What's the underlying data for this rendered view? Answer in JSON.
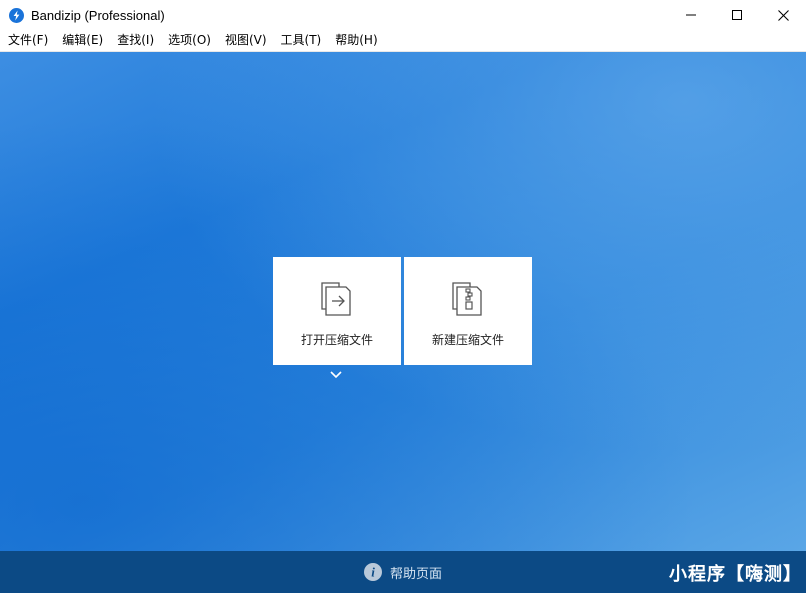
{
  "window": {
    "title": "Bandizip (Professional)",
    "controls": [
      "minimize",
      "maximize",
      "close"
    ]
  },
  "menu": {
    "items": [
      {
        "label": "文件(F)"
      },
      {
        "label": "编辑(E)"
      },
      {
        "label": "查找(I)"
      },
      {
        "label": "选项(O)"
      },
      {
        "label": "视图(V)"
      },
      {
        "label": "工具(T)"
      },
      {
        "label": "帮助(H)"
      }
    ]
  },
  "main": {
    "open_tile": {
      "label": "打开压缩文件",
      "icon": "open-archive-icon"
    },
    "new_tile": {
      "label": "新建压缩文件",
      "icon": "new-archive-icon"
    },
    "dropdown_icon": "chevron-down-icon"
  },
  "footer": {
    "help_label": "帮助页面",
    "help_icon": "info-icon",
    "watermark": "小程序【嗨测】"
  },
  "colors": {
    "background_top": "#3d8ee2",
    "background_mid": "#1f7ad9",
    "footer_bg": "#0c4a85",
    "app_icon": "#1a73d9"
  }
}
